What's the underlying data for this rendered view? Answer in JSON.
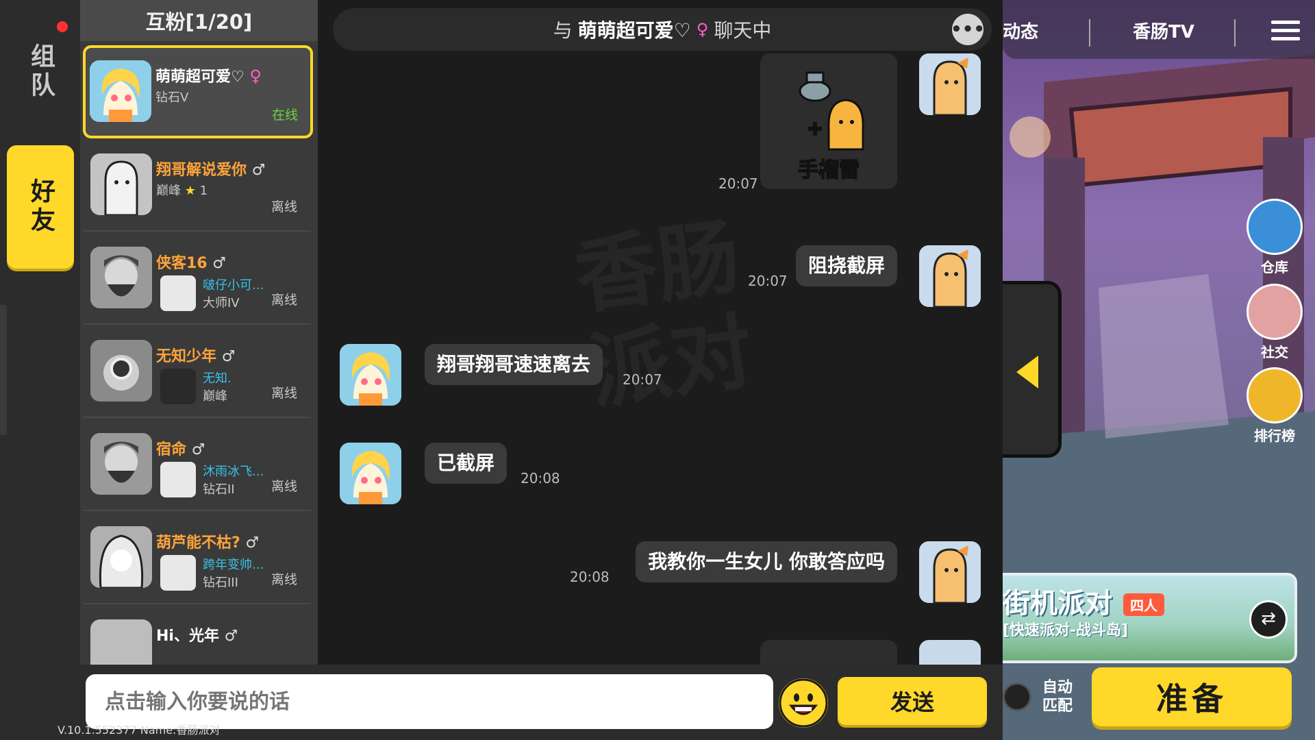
{
  "left_tabs": {
    "team_label": "组队",
    "friends_label": "好友"
  },
  "friends_panel": {
    "header": "互粉[1/20]",
    "friends": [
      {
        "name": "萌萌超可爱♡",
        "gender": "♀",
        "rank": "钻石V",
        "status": "在线",
        "active": true
      },
      {
        "name": "翔哥解说爱你",
        "gender": "♂",
        "rank": "巅峰",
        "star_count": "1",
        "status": "离线"
      },
      {
        "name": "侠客16",
        "gender": "♂",
        "partner_name": "啵仔小可...",
        "rank": "大师IV",
        "status": "离线"
      },
      {
        "name": "无知少年",
        "gender": "♂",
        "partner_name": "无知.",
        "rank": "巅峰",
        "status": "离线"
      },
      {
        "name": "宿命",
        "gender": "♂",
        "partner_name": "沐雨冰飞...",
        "rank": "钻石II",
        "status": "离线"
      },
      {
        "name": "葫芦能不枯?",
        "gender": "♂",
        "partner_name": "跨年变帅...",
        "rank": "钻石III",
        "status": "离线"
      },
      {
        "name": "Hi、光年",
        "gender": "♂"
      }
    ]
  },
  "chat": {
    "header_prefix": "与",
    "peer_name": "萌萌超可爱♡",
    "peer_gender": "♀",
    "header_suffix": "聊天中",
    "watermark": "香肠派对",
    "messages": [
      {
        "from": "me",
        "type": "sticker",
        "time": "20:07",
        "sticker_text": "手榴雷"
      },
      {
        "from": "me",
        "text": "阻挠截屏",
        "time": "20:07"
      },
      {
        "from": "peer",
        "text": "翔哥翔哥速速离去",
        "time": "20:07"
      },
      {
        "from": "peer",
        "text": "已截屏",
        "time": "20:08"
      },
      {
        "from": "me",
        "text": "我教你一生女儿  你敢答应吗",
        "time": "20:08"
      }
    ]
  },
  "input_bar": {
    "placeholder": "点击输入你要说的话",
    "send_label": "发送"
  },
  "version_text": "V.10.1.552377 Name:香肠派对",
  "scene": {
    "tabs": [
      "动态",
      "香肠TV"
    ],
    "side_buttons": [
      "仓库",
      "社交",
      "排行榜"
    ],
    "mode_title": "街机派对",
    "mode_badge": "四人",
    "mode_subtitle": "[快速派对-战斗岛]",
    "auto_match_label": "自动匹配",
    "ready_label": "准备"
  },
  "colors": {
    "accent": "#ffd82a",
    "online": "#6bd63a",
    "friend_name": "#ffa43a",
    "partner_name": "#36c3ea",
    "female": "#ff5fc4"
  }
}
